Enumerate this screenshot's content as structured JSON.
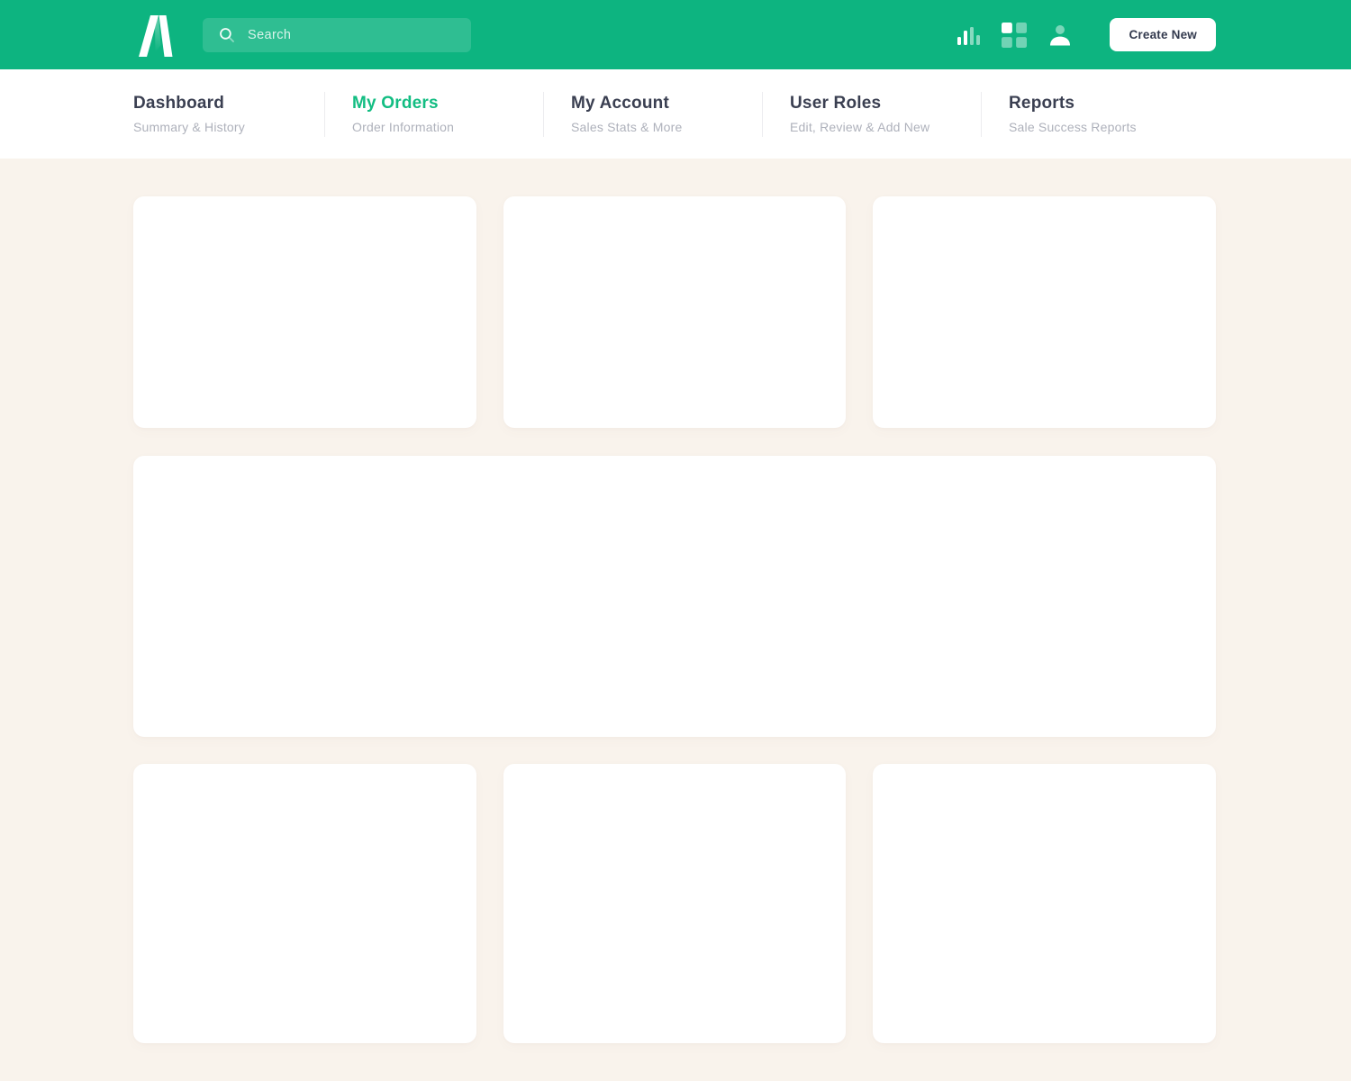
{
  "colors": {
    "header_green": "#0DB480",
    "active_tab_green": "#12BD82",
    "background_cream": "#F9F3EC",
    "title_text": "#3A3F51",
    "subtitle_text": "#AEB1BB",
    "create_button_text": "#333A4E",
    "divider": "#ECECEF"
  },
  "header": {
    "search": {
      "placeholder": "Search"
    },
    "create_button_label": "Create New",
    "icons": [
      "app-logo",
      "search-icon",
      "bar-chart-icon",
      "grid-icon",
      "user-icon"
    ]
  },
  "nav": {
    "tabs": [
      {
        "label": "Dashboard",
        "subtitle": "Summary & History",
        "active": false
      },
      {
        "label": "My Orders",
        "subtitle": "Order Information",
        "active": true
      },
      {
        "label": "My Account",
        "subtitle": "Sales Stats & More",
        "active": false
      },
      {
        "label": "User Roles",
        "subtitle": "Edit, Review & Add New",
        "active": false
      },
      {
        "label": "Reports",
        "subtitle": "Sale Success Reports",
        "active": false
      }
    ]
  },
  "content": {
    "card_placeholders": {
      "top_row": 3,
      "middle_full_width": 1,
      "bottom_row": 3
    }
  }
}
